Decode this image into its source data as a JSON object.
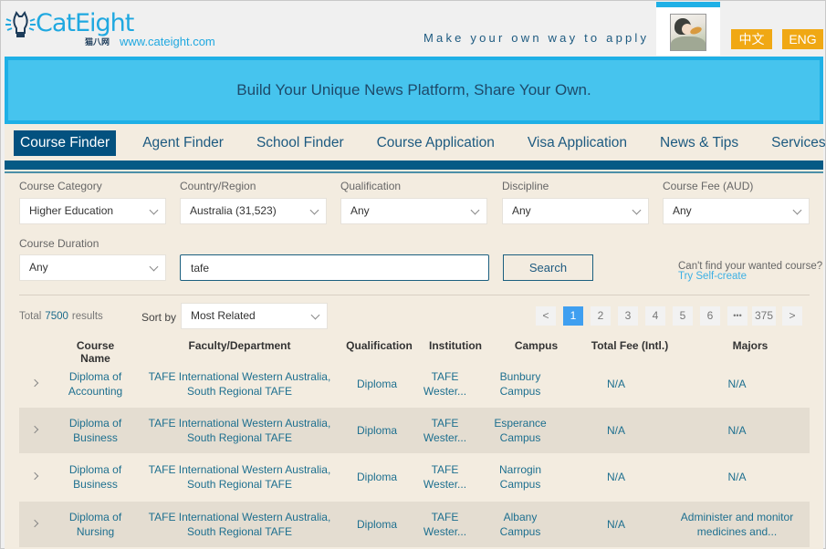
{
  "header": {
    "logo_text": "CatEight",
    "logo_sub": "猫八网",
    "site_url": "www.cateight.com",
    "tagline": "Make your own way to apply",
    "lang_zh": "中文",
    "lang_en": "ENG"
  },
  "banner": {
    "text": "Build Your Unique News Platform, Share Your Own."
  },
  "nav": {
    "items": [
      {
        "label": "Course Finder",
        "active": true
      },
      {
        "label": "Agent Finder"
      },
      {
        "label": "School Finder"
      },
      {
        "label": "Course Application"
      },
      {
        "label": "Visa Application"
      },
      {
        "label": "News & Tips"
      },
      {
        "label": "Services"
      }
    ]
  },
  "filters": {
    "course_category": {
      "label": "Course Category",
      "value": "Higher Education"
    },
    "country": {
      "label": "Country/Region",
      "value": "Australia (31,523)"
    },
    "qualification": {
      "label": "Qualification",
      "value": "Any"
    },
    "discipline": {
      "label": "Discipline",
      "value": "Any"
    },
    "course_fee": {
      "label": "Course Fee (AUD)",
      "value": "Any"
    },
    "course_duration": {
      "label": "Course Duration",
      "value": "Any"
    },
    "search_value": "tafe",
    "search_button": "Search",
    "cant_find": "Can't find your wanted course?",
    "self_create": "Try Self-create"
  },
  "results": {
    "total_prefix": "Total",
    "total_count": "7500",
    "total_suffix": "results",
    "sort_label": "Sort by",
    "sort_value": "Most Related",
    "pagination": {
      "prev": "<",
      "pages": [
        "1",
        "2",
        "3",
        "4",
        "5",
        "6"
      ],
      "current": "1",
      "ellipsis": "•••",
      "last": "375",
      "next": ">"
    },
    "columns": [
      "Course Name",
      "Faculty/Department",
      "Qualification",
      "Institution",
      "Campus",
      "Total Fee (Intl.)",
      "Majors"
    ],
    "rows": [
      {
        "course_name": [
          "Diploma of",
          "Accounting"
        ],
        "faculty": [
          "TAFE International Western Australia,",
          "South Regional TAFE"
        ],
        "qualification": "Diploma",
        "institution": [
          "TAFE",
          "Wester..."
        ],
        "campus": [
          "Bunbury",
          "Campus"
        ],
        "fee": "N/A",
        "majors": [
          "N/A"
        ]
      },
      {
        "course_name": [
          "Diploma of",
          "Business"
        ],
        "faculty": [
          "TAFE International Western Australia,",
          "South Regional TAFE"
        ],
        "qualification": "Diploma",
        "institution": [
          "TAFE",
          "Wester..."
        ],
        "campus": [
          "Esperance",
          "Campus"
        ],
        "fee": "N/A",
        "majors": [
          "N/A"
        ]
      },
      {
        "course_name": [
          "Diploma of",
          "Business"
        ],
        "faculty": [
          "TAFE International Western Australia,",
          "South Regional TAFE"
        ],
        "qualification": "Diploma",
        "institution": [
          "TAFE",
          "Wester..."
        ],
        "campus": [
          "Narrogin",
          "Campus"
        ],
        "fee": "N/A",
        "majors": [
          "N/A"
        ]
      },
      {
        "course_name": [
          "Diploma of",
          "Nursing"
        ],
        "faculty": [
          "TAFE International Western Australia,",
          "South Regional TAFE"
        ],
        "qualification": "Diploma",
        "institution": [
          "TAFE",
          "Wester..."
        ],
        "campus": [
          "Albany",
          "Campus"
        ],
        "fee": "N/A",
        "majors": [
          "Administer and monitor",
          "medicines and..."
        ]
      }
    ]
  },
  "colors": {
    "brand_blue": "#1fb0e6",
    "nav_active": "#03517f",
    "lang_button": "#f0a814",
    "page_active": "#3f9ff0",
    "link_text": "#1d6f8f"
  }
}
